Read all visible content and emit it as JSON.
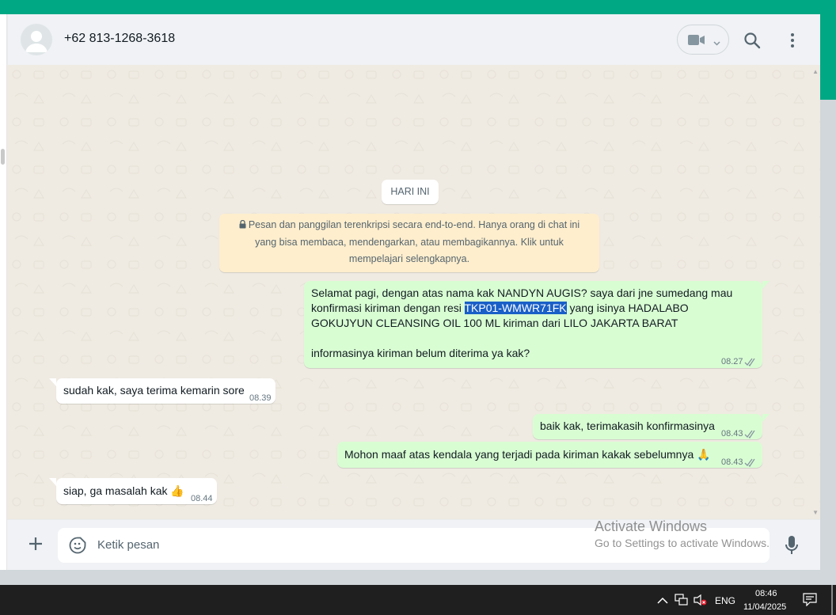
{
  "header": {
    "contact": "+62 813-1268-3618"
  },
  "date_chip": "HARI INI",
  "encryption_notice": "Pesan dan panggilan terenkripsi secara end-to-end. Hanya orang di chat ini yang bisa membaca, mendengarkan, atau membagikannya. Klik untuk mempelajari selengkapnya.",
  "messages": [
    {
      "direction": "outgoing",
      "text_parts": [
        "Selamat pagi, dengan atas nama kak NANDYN AUGIS? saya dari jne sumedang mau konfirmasi kiriman dengan resi ",
        "TKP01-WMWR71FK",
        " yang isinya HADALABO GOKUJYUN CLEANSING OIL 100 ML kiriman dari LILO JAKARTA BARAT"
      ],
      "text_line2": "informasinya kiriman belum diterima ya kak?",
      "time": "08.27",
      "status": "read"
    },
    {
      "direction": "incoming",
      "text": "sudah kak, saya terima kemarin sore",
      "time": "08.39"
    },
    {
      "direction": "outgoing",
      "text": "baik kak, terimakasih konfirmasinya",
      "time": "08.43",
      "status": "read"
    },
    {
      "direction": "outgoing",
      "text": "Mohon maaf atas kendala yang terjadi pada kiriman kakak sebelumnya",
      "emoji": "🙏",
      "time": "08.43",
      "status": "read"
    },
    {
      "direction": "incoming",
      "text": "siap, ga masalah kak",
      "emoji": "👍",
      "time": "08.44"
    }
  ],
  "composer": {
    "placeholder": "Ketik pesan"
  },
  "watermark": {
    "line1": "Activate Windows",
    "line2": "Go to Settings to activate Windows."
  },
  "taskbar": {
    "language": "ENG",
    "time": "08:46",
    "date": "11/04/2025"
  },
  "colors": {
    "accent": "#00a884",
    "outgoing_bubble": "#d9fdd3",
    "incoming_bubble": "#ffffff",
    "wallpaper": "#efeae2",
    "read_ticks": "#8696a0",
    "selection": "#1a5fc8"
  },
  "icons": [
    "default-avatar-icon",
    "video-call-icon",
    "chevron-down-icon",
    "search-icon",
    "kebab-menu-icon",
    "lock-icon",
    "double-check-icon",
    "plus-icon",
    "sticker-icon",
    "mic-icon",
    "chevron-up-icon",
    "network-icon",
    "volume-muted-icon",
    "notification-icon"
  ]
}
